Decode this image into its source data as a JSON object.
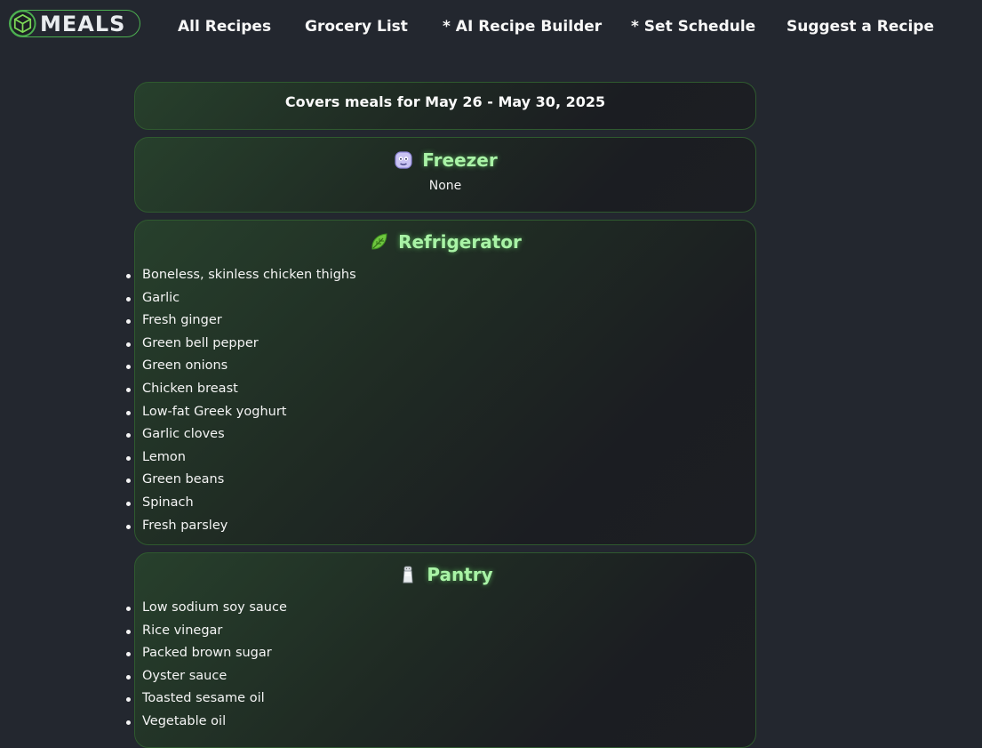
{
  "nav": {
    "logo_text": "MEALS",
    "links": [
      "All Recipes",
      "Grocery List",
      "* AI Recipe Builder",
      "* Set Schedule",
      "Suggest a Recipe"
    ]
  },
  "cover": {
    "text": "Covers meals for May 26 - May 30, 2025"
  },
  "freezer": {
    "title": "Freezer",
    "icon": "ice-cube-face-icon",
    "empty_text": "None"
  },
  "refrigerator": {
    "title": "Refrigerator",
    "icon": "leafy-green-icon",
    "items": [
      "Boneless, skinless chicken thighs",
      "Garlic",
      "Fresh ginger",
      "Green bell pepper",
      "Green onions",
      "Chicken breast",
      "Low-fat Greek yoghurt",
      "Garlic cloves",
      "Lemon",
      "Green beans",
      "Spinach",
      "Fresh parsley"
    ]
  },
  "pantry": {
    "title": "Pantry",
    "icon": "salt-shaker-icon",
    "items": [
      "Low sodium soy sauce",
      "Rice vinegar",
      "Packed brown sugar",
      "Oyster sauce",
      "Toasted sesame oil",
      "Vegetable oil"
    ]
  },
  "colors": {
    "background": "#23272f",
    "accent_green": "#4caf50",
    "title_green": "#a9f3a6",
    "card_border": "#2f5a2f"
  }
}
